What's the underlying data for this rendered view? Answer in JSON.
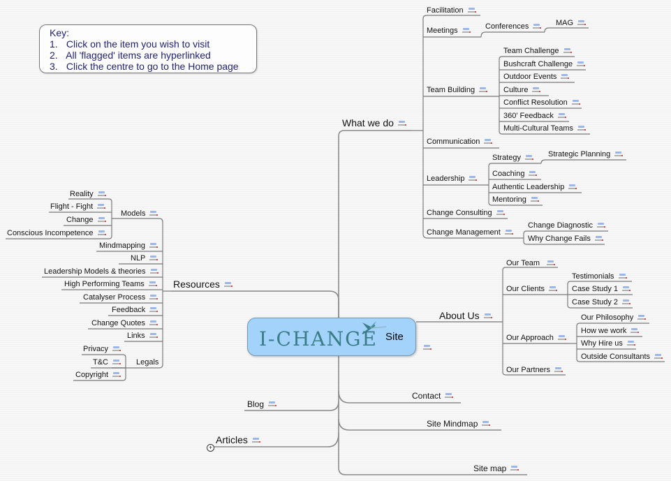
{
  "key": {
    "title": "Key:",
    "items": [
      {
        "num": "1.",
        "text": "Click on the item you wish to visit"
      },
      {
        "num": "2.",
        "text": "All 'flagged' items are hyperlinked"
      },
      {
        "num": "3.",
        "text": "Click the centre to go to the Home page"
      }
    ]
  },
  "center": {
    "logo": "I-CHANGE",
    "label": "Site",
    "icon": "link-icon"
  },
  "colors": {
    "center_fill": "#a3d3fb",
    "key_text": "#1f1f70",
    "branch_line": "#7a7a7a"
  },
  "what_we_do": {
    "label": "What we do",
    "facilitation": "Facilitation",
    "meetings": "Meetings",
    "conferences": "Conferences",
    "mag": "MAG",
    "team_building": "Team Building",
    "team_building_items": [
      "Team Challenge",
      "Bushcraft Challenge",
      "Outdoor Events",
      "Culture",
      "Conflict Resolution",
      "360' Feedback",
      "Multi-Cultural Teams"
    ],
    "communication": "Communication",
    "leadership": "Leadership",
    "strategy": "Strategy",
    "strategic_planning": "Strategic Planning",
    "leadership_items": [
      "Coaching",
      "Authentic Leadership",
      "Mentoring"
    ],
    "change_consulting": "Change Consulting",
    "change_management": "Change Management",
    "change_management_items": [
      "Change Diagnostic",
      "Why Change Fails"
    ]
  },
  "about_us": {
    "label": "About Us",
    "our_team": "Our Team",
    "our_clients": "Our Clients",
    "clients_items": [
      "Testimonials",
      "Case Study 1",
      "Case Study 2"
    ],
    "our_approach": "Our Approach",
    "approach_items": [
      "Our Philosophy",
      "How we work",
      "Why Hire us",
      "Outside Consultants"
    ],
    "our_partners": "Our Partners"
  },
  "resources": {
    "label": "Resources",
    "models": "Models",
    "models_items": [
      "Reality",
      "Flight - Fight",
      "Change",
      "Conscious Incompetence"
    ],
    "items": [
      "Mindmapping",
      "NLP",
      "Leadership Models & theories",
      "High Performing Teams",
      "Catalyser Process",
      "Feedback",
      "Change Quotes",
      "Links"
    ],
    "legals": "Legals",
    "legals_items": [
      "Privacy",
      "T&C",
      "Copyright"
    ]
  },
  "blog": "Blog",
  "articles": "Articles",
  "articles_expander": "+",
  "contact": "Contact",
  "site_mindmap": "Site Mindmap",
  "site_map": "Site map"
}
